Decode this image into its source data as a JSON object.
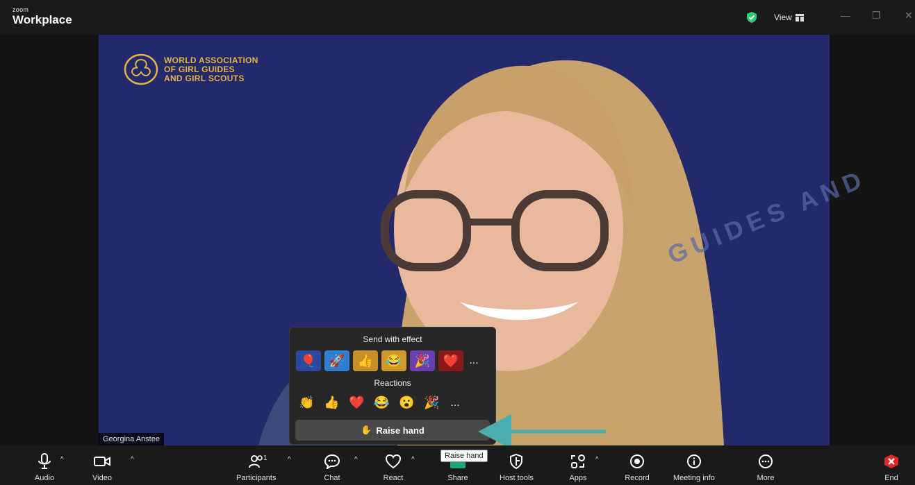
{
  "app": {
    "brand_small": "zoom",
    "brand_big": "Workplace",
    "view_label": "View"
  },
  "video": {
    "logo_lines": [
      "WORLD ASSOCIATION",
      "OF GIRL GUIDES",
      "AND GIRL SCOUTS"
    ],
    "watermark": "GUIDES AND",
    "participant_name": "Georgina Anstee"
  },
  "reactions_popup": {
    "effect_title": "Send with effect",
    "effects": [
      "🎈",
      "🚀",
      "👍",
      "😂",
      "🎉",
      "❤️"
    ],
    "reactions_title": "Reactions",
    "reactions": [
      "👏",
      "👍",
      "❤️",
      "😂",
      "😮",
      "🎉"
    ],
    "more": "...",
    "raise_hand_icon": "✋",
    "raise_hand_label": "Raise hand"
  },
  "tooltip": "Raise hand",
  "toolbar": {
    "audio": "Audio",
    "video": "Video",
    "participants": "Participants",
    "participant_count": "1",
    "chat": "Chat",
    "react": "React",
    "share": "Share",
    "host_tools": "Host tools",
    "apps": "Apps",
    "record": "Record",
    "meeting_info": "Meeting info",
    "more": "More",
    "end": "End"
  },
  "colors": {
    "accent_green": "#19a974",
    "arrow": "#4aaeae",
    "end_red": "#e02828",
    "logo_gold": "#e2b348"
  }
}
